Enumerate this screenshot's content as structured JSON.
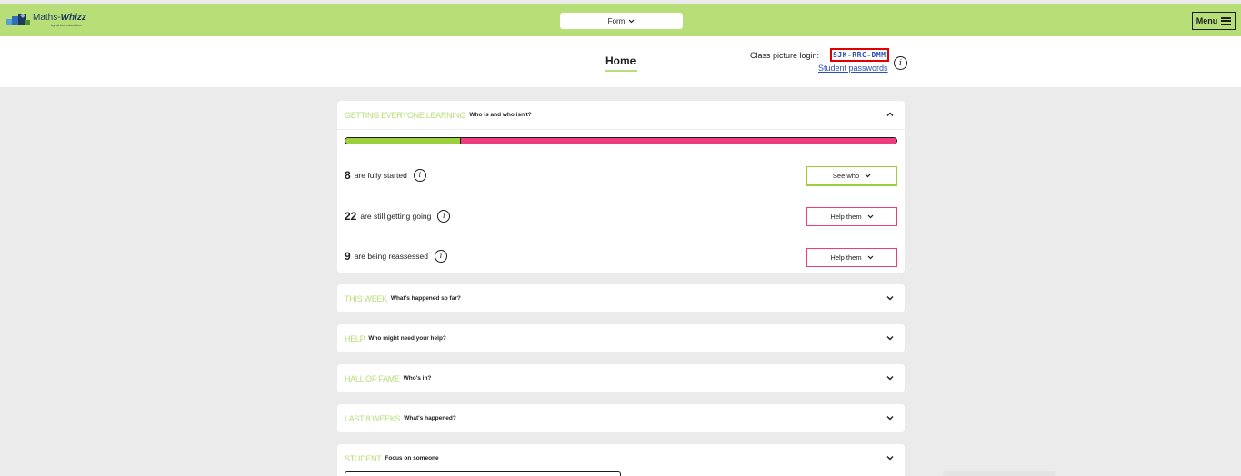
{
  "app": {
    "logo_main": "Maths-",
    "logo_bold": "Whizz",
    "logo_sub": "by whizz education"
  },
  "topbar": {
    "class_select_value": "Form",
    "menu_label": "Menu"
  },
  "header": {
    "home_tab": "Home",
    "login_label": "Class picture login:",
    "login_code": "SJK-RRC-DMM",
    "student_passwords": "Student passwords",
    "info_glyph": "i"
  },
  "sections": {
    "getting_learning": {
      "title": "GETTING EVERYONE LEARNING",
      "subtitle": "Who is and who isn't?",
      "progress": {
        "started": 8,
        "getting_going": 22,
        "total_shown": 39,
        "green_fraction": 0.21
      },
      "rows": [
        {
          "count": "8",
          "text": "are fully started",
          "button": "See who"
        },
        {
          "count": "22",
          "text": "are still getting going",
          "button": "Help them"
        },
        {
          "count": "9",
          "text": "are being reassessed",
          "button": "Help them"
        }
      ]
    },
    "this_week": {
      "title": "THIS WEEK",
      "subtitle": "What's happened so far?"
    },
    "help": {
      "title": "HELP",
      "subtitle": "Who might need your help?"
    },
    "hall_of_fame": {
      "title": "HALL OF FAME",
      "subtitle": "Who's in?"
    },
    "last_8_weeks": {
      "title": "LAST 8 WEEKS",
      "subtitle": "What's happened?"
    },
    "student": {
      "title": "STUDENT",
      "subtitle": "Focus on someone"
    }
  },
  "colors": {
    "brand_green": "#b7de77",
    "progress_green": "#9bcf3c",
    "progress_pink": "#ee3d7f",
    "link_blue": "#2b4fb5",
    "highlight_red": "#e00000"
  },
  "icons": {
    "logo": "maths-whizz-logo-icon",
    "select_caret": "chevron-down-icon",
    "menu": "hamburger-icon",
    "info": "info-icon",
    "collapse": "chevron-up-icon",
    "expand": "chevron-down-icon"
  }
}
